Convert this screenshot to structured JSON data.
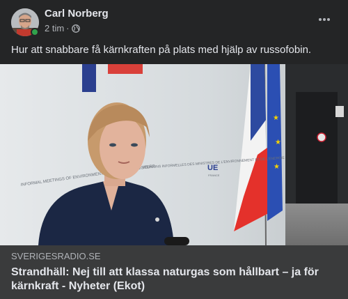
{
  "post": {
    "author": "Carl Norberg",
    "time": "2 tim",
    "separator": "·",
    "privacy_icon": "globe-icon",
    "more_icon": "more-horizontal-icon",
    "text": "Hur att snabbare få kärnkraften på plats med hjälp av russofobin."
  },
  "image": {
    "backdrop_text_left": "INFORMAL MEETINGS OF ENVIRONMENT AND ENERGY MINISTERS",
    "backdrop_text_center": "RÉUNIONS INFORMELLES DES MINISTRES DE L'ENVIRONNEMENT ET DE L'ÉNERGIE",
    "logo_text": "UE",
    "logo_subtext": "FRANCE"
  },
  "link": {
    "domain": "SVERIGESRADIO.SE",
    "headline": "Strandhäll: Nej till att klassa naturgas som hållbart – ja för kärnkraft - Nyheter (Ekot)"
  },
  "colors": {
    "background": "#242526",
    "link_background": "#3a3b3c",
    "online": "#31a24c"
  }
}
